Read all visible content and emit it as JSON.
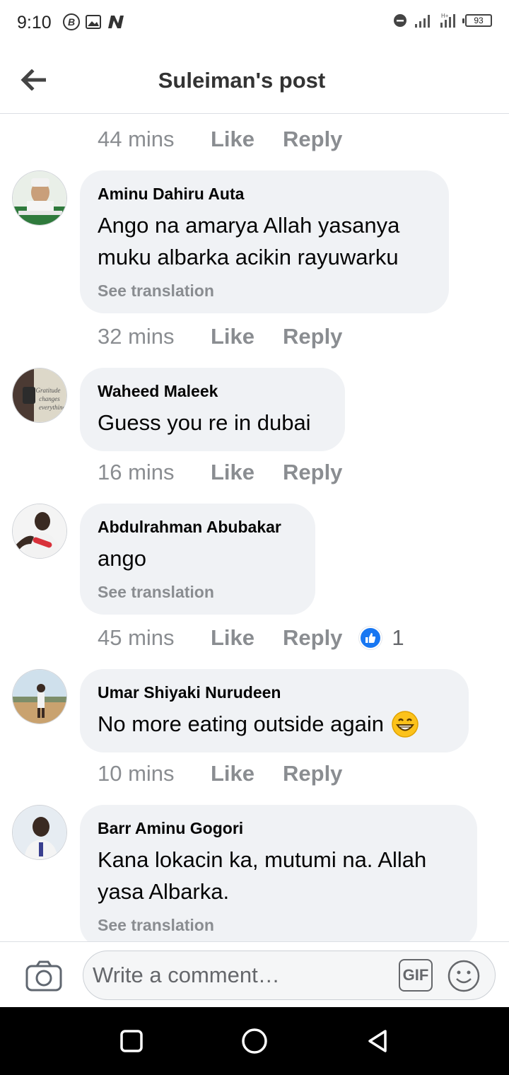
{
  "status_bar": {
    "time": "9:10",
    "battery": "93",
    "left_icons": [
      "b-circle-icon",
      "gallery-icon",
      "n-logo-icon"
    ],
    "right_icons": [
      "dnd-icon",
      "signal-icon",
      "signal-icon",
      "battery-icon"
    ]
  },
  "header": {
    "title": "Suleiman's post",
    "back_icon": "arrow-left-icon"
  },
  "top_meta": {
    "time": "44 mins",
    "like": "Like",
    "reply": "Reply"
  },
  "comments": [
    {
      "author": "Aminu Dahiru Auta",
      "lines": [
        "Ango na amarya Allah yasanya",
        "muku albarka acikin rayuwarku"
      ],
      "see_translation": "See translation",
      "time": "32 mins",
      "like": "Like",
      "reply": "Reply"
    },
    {
      "author": "Waheed Maleek",
      "lines": [
        "Guess you re in dubai"
      ],
      "time": "16 mins",
      "like": "Like",
      "reply": "Reply"
    },
    {
      "author": "Abdulrahman Abubakar",
      "lines": [
        "ango"
      ],
      "see_translation": "See translation",
      "time": "45 mins",
      "like": "Like",
      "reply": "Reply",
      "reaction_count": "1"
    },
    {
      "author": "Umar Shiyaki Nurudeen",
      "lines": [
        "No more eating outside again"
      ],
      "time": "10 mins",
      "like": "Like",
      "reply": "Reply"
    },
    {
      "author": "Barr Aminu Gogori",
      "lines": [
        "Kana lokacin ka, mutumi na. Allah",
        "yasa Albarka."
      ],
      "see_translation": "See translation"
    }
  ],
  "composer": {
    "placeholder": "Write a comment…",
    "gif_label": "GIF",
    "camera_icon": "camera-icon",
    "emoji_icon": "smiley-icon"
  },
  "nav_bar": {
    "icons": [
      "recent-apps-icon",
      "home-icon",
      "back-icon"
    ]
  },
  "colors": {
    "bubble": "#f0f2f5",
    "meta_text": "#8a8d91",
    "like_blue": "#1877f2"
  }
}
